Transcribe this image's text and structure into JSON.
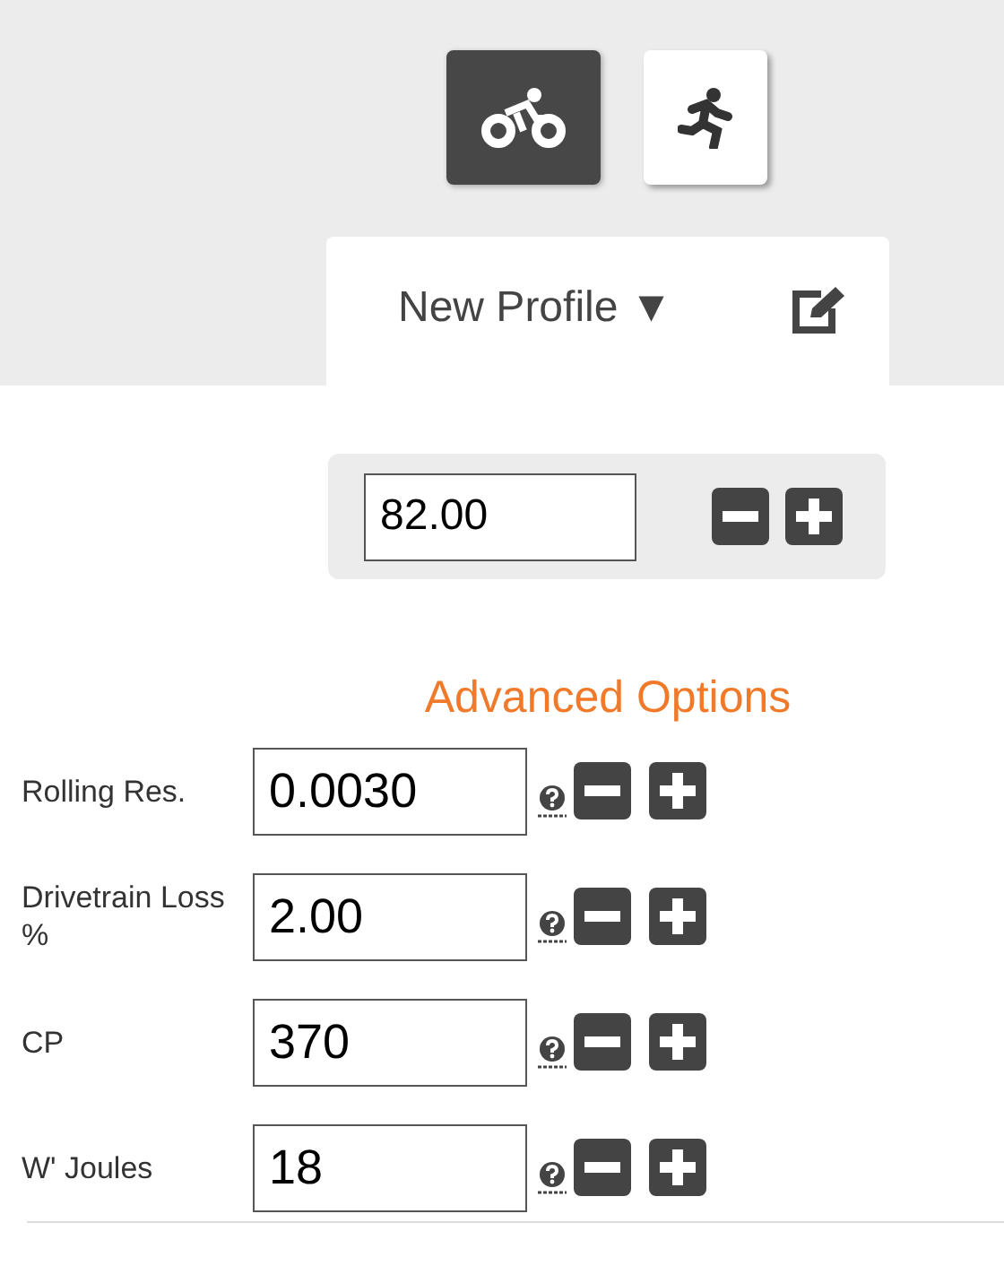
{
  "sports": [
    {
      "kind": "bike",
      "selected": true
    },
    {
      "kind": "run",
      "selected": false
    }
  ],
  "profile": {
    "name": "New Profile",
    "caret": "▼"
  },
  "weight": {
    "value": "82.00"
  },
  "advanced": {
    "title": "Advanced Options"
  },
  "fields": [
    {
      "label": "Rolling Res.",
      "value": "0.0030"
    },
    {
      "label": "Drivetrain Loss %",
      "value": "2.00"
    },
    {
      "label": "CP",
      "value": "370"
    },
    {
      "label": "W' Joules",
      "value": "18"
    }
  ]
}
